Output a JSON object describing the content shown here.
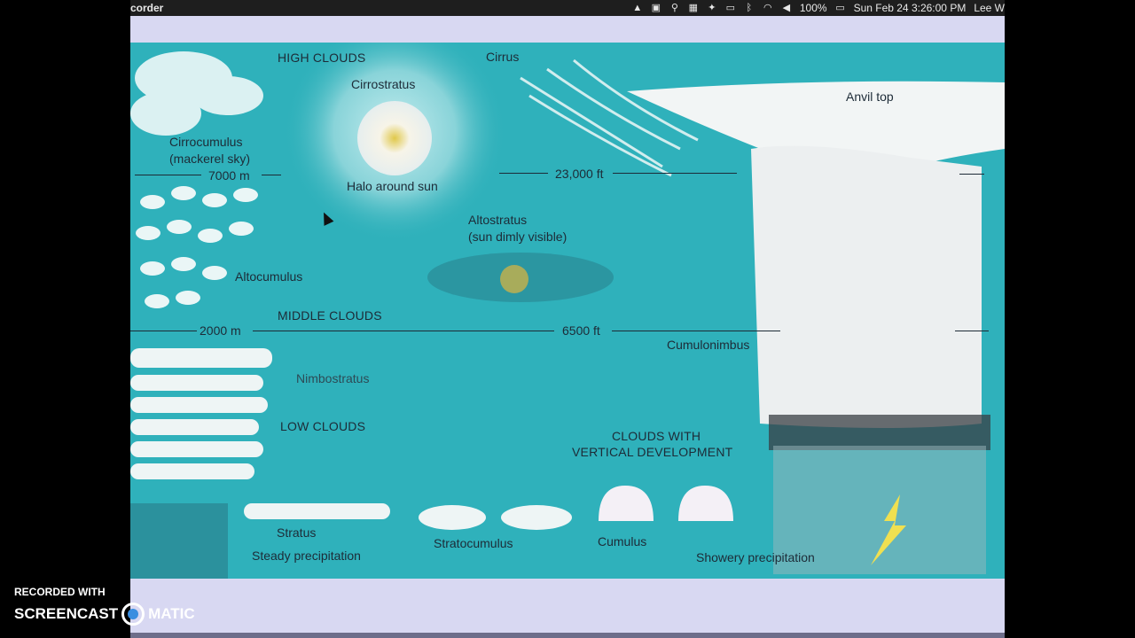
{
  "menubar": {
    "app_name": "corder",
    "status": {
      "battery": "100%",
      "datetime": "Sun Feb 24  3:26:00 PM",
      "user": "Lee W"
    },
    "icons": [
      "vlc-icon",
      "app-icon",
      "search-icon",
      "grid-icon",
      "mouse-icon",
      "airplay-icon",
      "bluetooth-icon",
      "wifi-icon",
      "volume-icon",
      "battery-icon"
    ]
  },
  "figure": {
    "headings": {
      "high": "HIGH CLOUDS",
      "middle": "MIDDLE CLOUDS",
      "low": "LOW CLOUDS",
      "vertical_1": "CLOUDS WITH",
      "vertical_2": "VERTICAL DEVELOPMENT"
    },
    "altitudes": {
      "high_m": "7000 m",
      "high_ft": "23,000 ft",
      "mid_m": "2000 m",
      "mid_ft": "6500 ft"
    },
    "cloud_labels": {
      "cirrus": "Cirrus",
      "cirrostratus": "Cirrostratus",
      "halo": "Halo around sun",
      "cirrocumulus_1": "Cirrocumulus",
      "cirrocumulus_2": "(mackerel sky)",
      "altostratus_1": "Altostratus",
      "altostratus_2": "(sun dimly visible)",
      "altocumulus": "Altocumulus",
      "anvil": "Anvil top",
      "cumulonimbus": "Cumulonimbus",
      "nimbostratus": "Nimbostratus",
      "stratus": "Stratus",
      "steady": "Steady precipitation",
      "stratocumulus": "Stratocumulus",
      "cumulus": "Cumulus",
      "showery": "Showery precipitation"
    }
  },
  "watermark": {
    "recorded": "RECORDED WITH",
    "brand_left": "SCREENCAST",
    "brand_right": "MATIC"
  }
}
